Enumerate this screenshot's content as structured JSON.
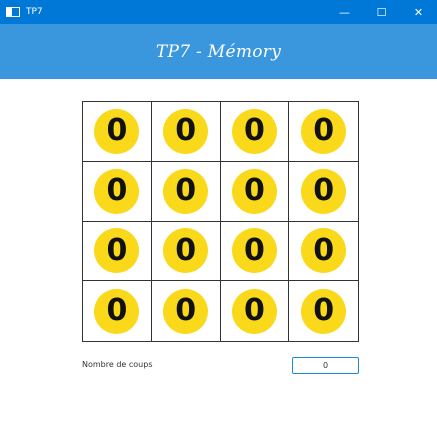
{
  "window": {
    "title": "TP7",
    "minimize_glyph": "—",
    "maximize_glyph": "☐",
    "close_glyph": "✕"
  },
  "header": {
    "title": "TP7 - Mémory"
  },
  "board": {
    "cards": [
      "0",
      "0",
      "0",
      "0",
      "0",
      "0",
      "0",
      "0",
      "0",
      "0",
      "0",
      "0",
      "0",
      "0",
      "0",
      "0"
    ],
    "token_color": "#f9d91a"
  },
  "footer": {
    "moves_label": "Nombre de coups",
    "moves_value": "0"
  },
  "colors": {
    "titlebar": "#0078d7",
    "header": "#3a97de",
    "field_border": "#1f8ad2"
  }
}
